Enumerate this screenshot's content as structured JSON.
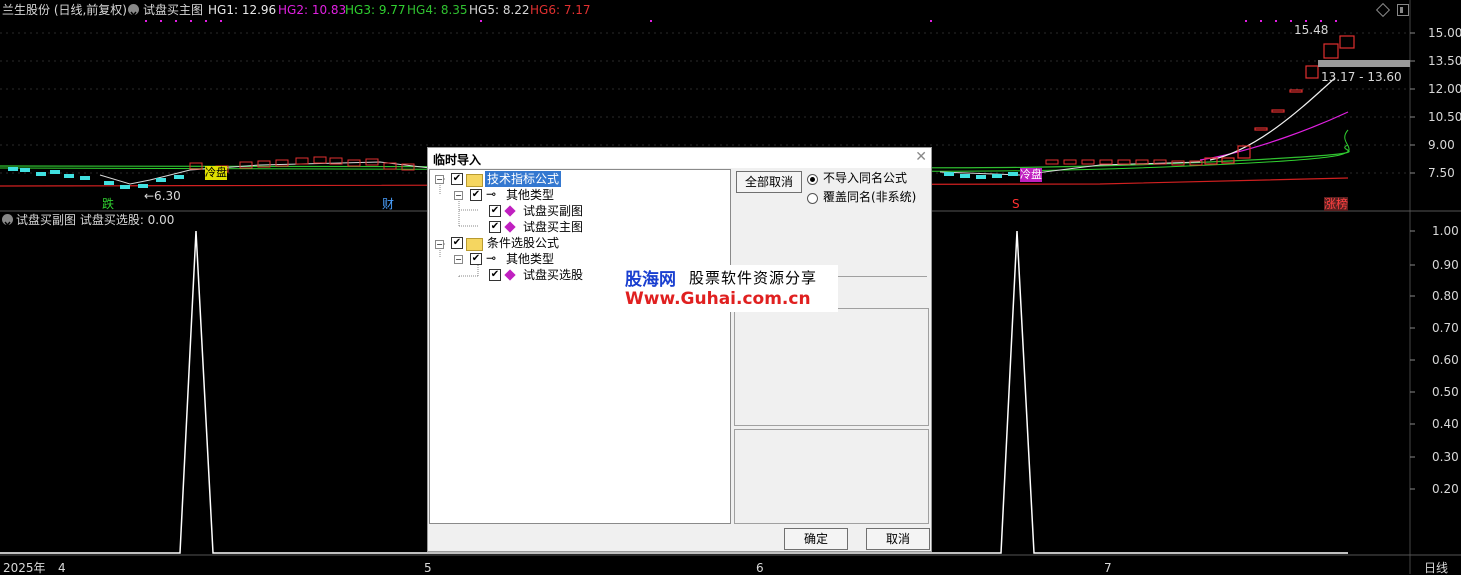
{
  "top_chart": {
    "stock_name": "兰生股份 (日线,前复权)",
    "indicator_name": "试盘买主图",
    "hg": [
      {
        "label": "HG1: 12.96",
        "color": "#e8e8e8"
      },
      {
        "label": "HG2: 10.83",
        "color": "#e020e0"
      },
      {
        "label": "HG3: 9.77",
        "color": "#30d030"
      },
      {
        "label": "HG4: 8.35",
        "color": "#30c030"
      },
      {
        "label": "HG5: 8.22",
        "color": "#d8d8d8"
      },
      {
        "label": "HG6: 7.17",
        "color": "#e03030"
      }
    ],
    "price_axis": [
      "15.00",
      "13.50",
      "12.00",
      "10.50",
      "9.00",
      "7.50"
    ],
    "high_label": "15.48",
    "low_label": "←6.30",
    "range_label": "13.17 - 13.60",
    "event_labels": {
      "fall": "跌",
      "finance": "财",
      "s": "S",
      "limit_up": "涨榜",
      "cold1": "冷盘",
      "cold2": "冷盘"
    }
  },
  "bottom_chart": {
    "header": "试盘买副图  试盘买选股: 0.00",
    "axis": [
      "1.00",
      "0.90",
      "0.80",
      "0.70",
      "0.60",
      "0.50",
      "0.40",
      "0.30",
      "0.20"
    ]
  },
  "date_axis": {
    "year": "2025年",
    "months": [
      "4",
      "5",
      "6",
      "7"
    ],
    "period": "日线"
  },
  "dialog": {
    "title": "临时导入",
    "tree": [
      {
        "label": "技术指标公式",
        "level": 0,
        "selected": true
      },
      {
        "label": "其他类型",
        "level": 1
      },
      {
        "label": "试盘买副图",
        "level": 2
      },
      {
        "label": "试盘买主图",
        "level": 2
      },
      {
        "label": "条件选股公式",
        "level": 0
      },
      {
        "label": "其他类型",
        "level": 1
      },
      {
        "label": "试盘买选股",
        "level": 2
      }
    ],
    "cancel_all": "全部取消",
    "radio_no_import": "不导入同名公式",
    "radio_overwrite": "覆盖同名(非系统)",
    "ok": "确定",
    "cancel": "取消"
  },
  "watermark": {
    "name": "股海网",
    "tagline": "股票软件资源分享",
    "url": "Www.Guhai.com.cn"
  }
}
